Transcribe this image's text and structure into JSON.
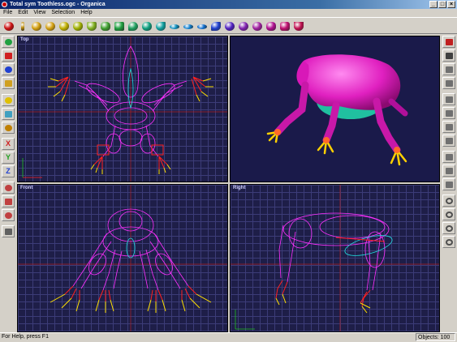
{
  "window": {
    "title": "Total sym Toothless.ogc - Organica",
    "buttons": [
      "_",
      "□",
      "×"
    ]
  },
  "menu": [
    "File",
    "Edit",
    "View",
    "Selection",
    "Help"
  ],
  "toolbar": {
    "tools": [
      {
        "name": "sphere-red-icon",
        "color": "#cc1010"
      },
      {
        "name": "rod-icon",
        "color": "#c09010"
      },
      {
        "name": "ellipsoid-icon",
        "color": "#d4a010"
      },
      {
        "name": "torus-icon",
        "color": "#d4a010"
      },
      {
        "name": "egg-icon",
        "color": "#c0b000"
      },
      {
        "name": "pear-icon",
        "color": "#a0b000"
      },
      {
        "name": "cone-icon",
        "color": "#80b020"
      },
      {
        "name": "blob-icon",
        "color": "#40a030"
      },
      {
        "name": "prism-icon",
        "color": "#20a040"
      },
      {
        "name": "drop-icon",
        "color": "#20a060"
      },
      {
        "name": "capsule-icon",
        "color": "#10a080"
      },
      {
        "name": "teardrop-icon",
        "color": "#10a0a0"
      },
      {
        "name": "disc-icon",
        "color": "#1090c0"
      },
      {
        "name": "flat-ellipse-icon",
        "color": "#1080d0"
      },
      {
        "name": "lens-icon",
        "color": "#1070d0"
      },
      {
        "name": "crescent-icon",
        "color": "#2040d0"
      },
      {
        "name": "bean-icon",
        "color": "#5020c0"
      },
      {
        "name": "oval-icon",
        "color": "#8020b0"
      },
      {
        "name": "ring-icon",
        "color": "#a020a0"
      },
      {
        "name": "hourglass-icon",
        "color": "#b01090"
      },
      {
        "name": "cylinder-icon",
        "color": "#c01070"
      },
      {
        "name": "bowl-icon",
        "color": "#c01050"
      }
    ]
  },
  "left_toolbar": [
    {
      "name": "move-tool-icon",
      "glyph": ""
    },
    {
      "name": "scale-tool-icon",
      "glyph": ""
    },
    {
      "name": "rotate-tool-icon",
      "glyph": ""
    },
    {
      "name": "paint-tool-icon",
      "glyph": ""
    },
    {
      "name": "color-tool-icon",
      "glyph": ""
    },
    {
      "name": "sphere-tool-icon",
      "glyph": ""
    },
    {
      "name": "material-tool-icon",
      "glyph": ""
    },
    {
      "name": "axis-x-button",
      "glyph": "X"
    },
    {
      "name": "axis-y-button",
      "glyph": "Y"
    },
    {
      "name": "axis-z-button",
      "glyph": "Z"
    },
    {
      "name": "select-tool-icon",
      "glyph": ""
    },
    {
      "name": "group-tool-icon",
      "glyph": ""
    },
    {
      "name": "figure-tool-icon",
      "glyph": ""
    },
    {
      "name": "link-tool-icon",
      "glyph": ""
    }
  ],
  "right_toolbar": [
    {
      "name": "grid-toggle-icon"
    },
    {
      "name": "render-icon"
    },
    {
      "name": "view-rotate-icon"
    },
    {
      "name": "view-pan-icon"
    },
    {
      "name": "view-box-icon"
    },
    {
      "name": "view-zoom-icon"
    },
    {
      "name": "arm-pose-icon"
    },
    {
      "name": "hand-pose-icon"
    },
    {
      "name": "path-icon"
    },
    {
      "name": "vertex-icon"
    },
    {
      "name": "nodes-icon"
    },
    {
      "name": "undo-icon"
    },
    {
      "name": "redo-icon"
    },
    {
      "name": "refresh-icon"
    },
    {
      "name": "magnet-icon"
    }
  ],
  "viewports": {
    "top": {
      "label": "Top"
    },
    "perspective": {
      "label": ""
    },
    "front": {
      "label": "Front"
    },
    "right": {
      "label": "Right"
    }
  },
  "status": {
    "left": "For Help, press F1",
    "right": "Objects: 100"
  },
  "colors": {
    "wire_magenta": "#ff30ff",
    "wire_red": "#ff2020",
    "wire_yellow": "#ffe000",
    "wire_cyan": "#20e0e0",
    "model_pink": "#e020c0"
  }
}
